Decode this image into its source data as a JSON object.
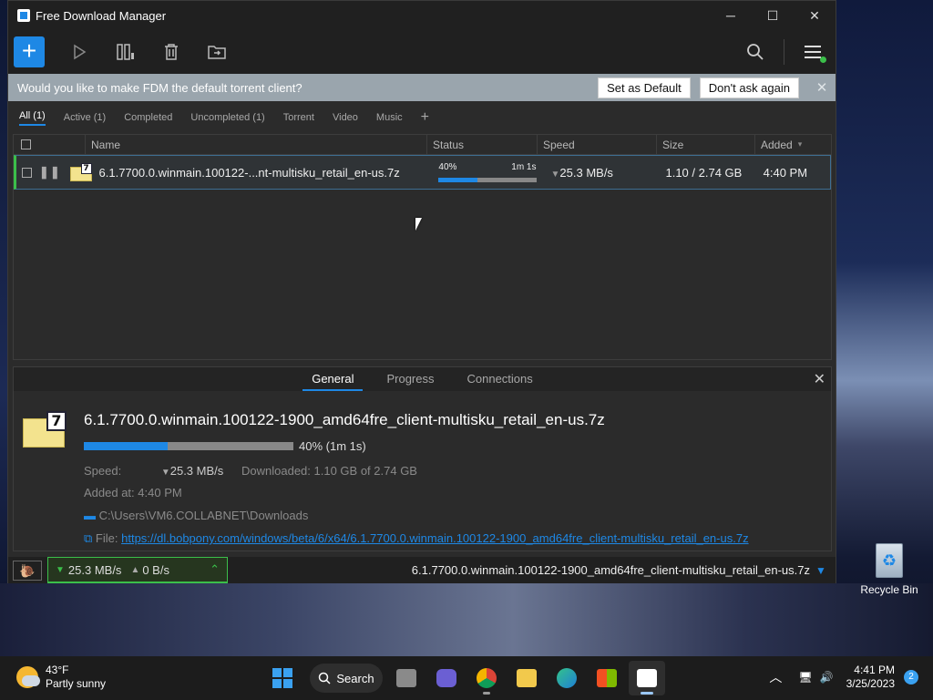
{
  "window": {
    "title": "Free Download Manager",
    "minimize": "─",
    "maximize": "☐",
    "close": "✕"
  },
  "toolbar": {
    "add_label": "+"
  },
  "notification": {
    "text": "Would you like to make FDM the default torrent client?",
    "set_default": "Set as Default",
    "dont_ask": "Don't ask again",
    "close": "✕"
  },
  "filters": [
    {
      "label": "All (1)",
      "active": true
    },
    {
      "label": "Active (1)"
    },
    {
      "label": "Completed"
    },
    {
      "label": "Uncompleted (1)"
    },
    {
      "label": "Torrent"
    },
    {
      "label": "Video"
    },
    {
      "label": "Music"
    }
  ],
  "filter_add": "+",
  "list": {
    "columns": [
      "Name",
      "Status",
      "Speed",
      "Size",
      "Added"
    ],
    "rows": [
      {
        "name": "6.1.7700.0.winmain.100122-...nt-multisku_retail_en-us.7z",
        "progress_text": "40%",
        "progress": 0.4,
        "eta": "1m 1s",
        "speed": "25.3 MB/s",
        "size": "1.10 / 2.74 GB",
        "added": "4:40 PM"
      }
    ]
  },
  "details": {
    "tabs": [
      "General",
      "Progress",
      "Connections"
    ],
    "active_tab": "General",
    "filename": "6.1.7700.0.winmain.100122-1900_amd64fre_client-multisku_retail_en-us.7z",
    "progress": 0.4,
    "progress_text": "40% (1m 1s)",
    "speed_label": "Speed:",
    "speed_value": "25.3 MB/s",
    "downloaded_label": "Downloaded:",
    "downloaded_value": "1.10 GB of 2.74 GB",
    "added_label": "Added at:",
    "added_value": "4:40 PM",
    "folder": "C:\\Users\\VM6.COLLABNET\\Downloads",
    "file_label": "File:",
    "file_url": "https://dl.bobpony.com/windows/beta/6/x64/6.1.7700.0.winmain.100122-1900_amd64fre_client-multisku_retail_en-us.7z"
  },
  "statusbar": {
    "down_speed": "25.3 MB/s",
    "up_speed": "0 B/s",
    "current_file": "6.1.7700.0.winmain.100122-1900_amd64fre_client-multisku_retail_en-us.7z"
  },
  "desktop": {
    "recycle_bin": "Recycle Bin"
  },
  "taskbar": {
    "temperature": "43°F",
    "weather": "Partly sunny",
    "search": "Search",
    "time": "4:41 PM",
    "date": "3/25/2023",
    "notifications": "2"
  },
  "colors": {
    "accent": "#1e88e5",
    "active_green": "#3bbf4a"
  }
}
